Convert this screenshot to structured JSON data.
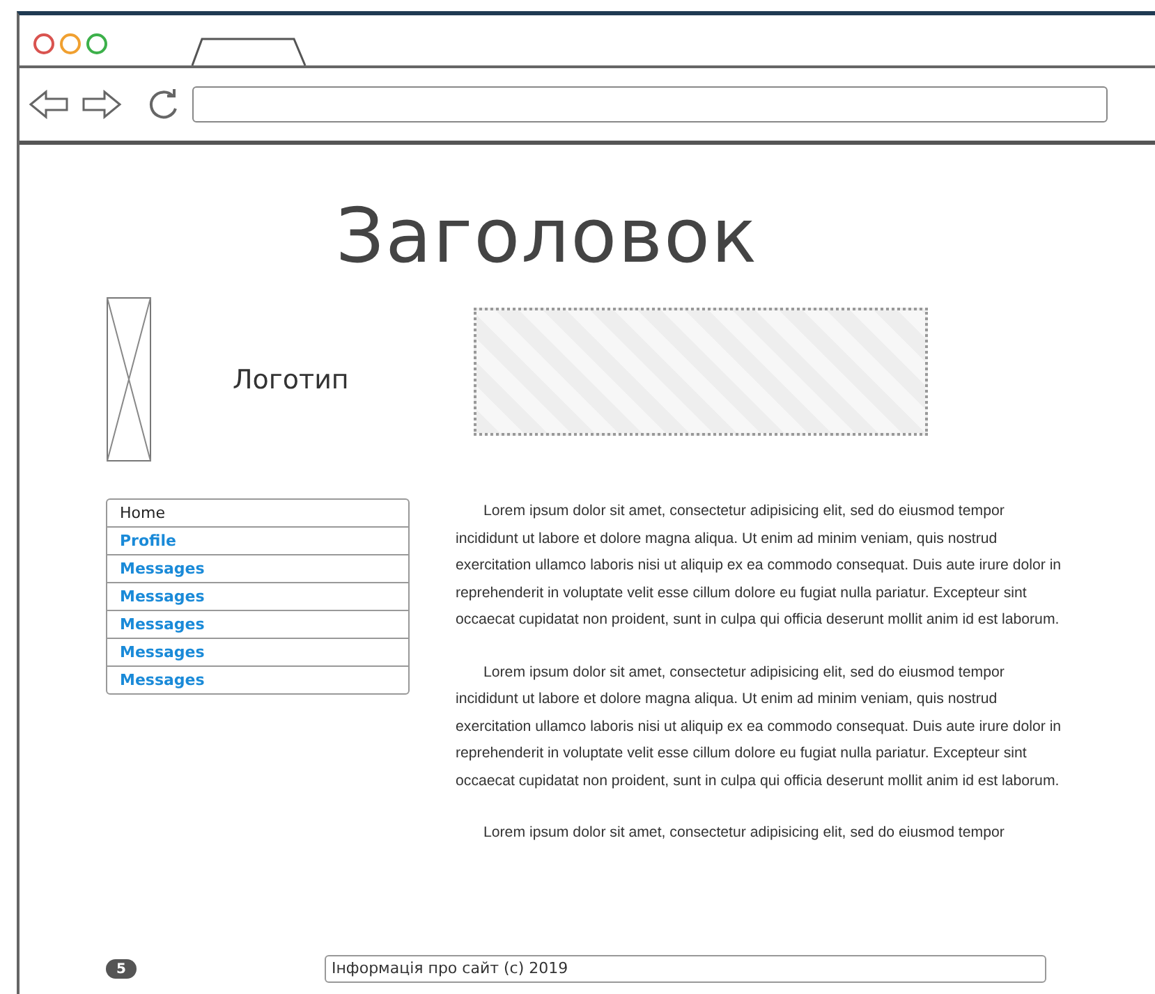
{
  "heading": "Заголовок",
  "logo": {
    "label": "Логотип"
  },
  "nav": [
    {
      "label": "Home",
      "selected": true
    },
    {
      "label": "Profile",
      "selected": false
    },
    {
      "label": "Messages",
      "selected": false
    },
    {
      "label": "Messages",
      "selected": false
    },
    {
      "label": "Messages",
      "selected": false
    },
    {
      "label": "Messages",
      "selected": false
    },
    {
      "label": "Messages",
      "selected": false
    }
  ],
  "paragraphs": [
    "Lorem ipsum dolor sit amet, consectetur adipisicing elit, sed do eiusmod tempor incididunt ut labore et dolore magna aliqua. Ut enim ad minim veniam, quis nostrud exercitation ullamco laboris nisi ut aliquip ex ea commodo consequat. Duis aute irure dolor in reprehenderit in voluptate velit esse cillum dolore eu fugiat nulla pariatur. Excepteur sint occaecat cupidatat non proident, sunt in culpa qui officia deserunt mollit anim id est laborum.",
    "Lorem ipsum dolor sit amet, consectetur adipisicing elit, sed do eiusmod tempor incididunt ut labore et dolore magna aliqua. Ut enim ad minim veniam, quis nostrud exercitation ullamco laboris nisi ut aliquip ex ea commodo consequat. Duis aute irure dolor in reprehenderit in voluptate velit esse cillum dolore eu fugiat nulla pariatur. Excepteur sint occaecat cupidatat non proident, sunt in culpa qui officia deserunt mollit anim id est laborum.",
    "Lorem ipsum dolor sit amet, consectetur adipisicing elit, sed do eiusmod tempor"
  ],
  "footer": {
    "badge": "5",
    "text": "Інформація про сайт (с) 2019"
  }
}
